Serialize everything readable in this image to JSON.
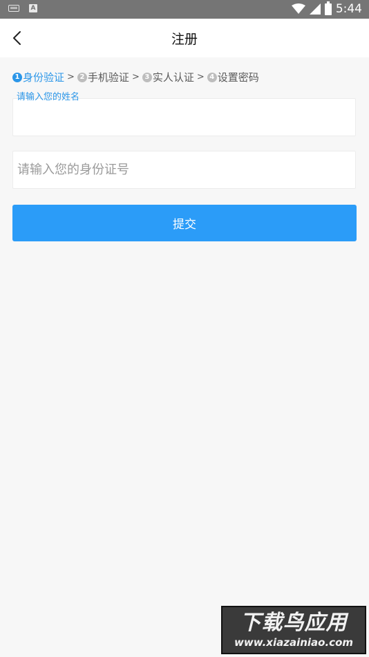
{
  "status_bar": {
    "time": "5:44",
    "left_icons": [
      "keyboard-icon",
      "a-badge-icon"
    ],
    "right_icons": [
      "wifi-icon",
      "signal-icon",
      "battery-icon"
    ]
  },
  "header": {
    "title": "注册",
    "back_icon": "chevron-left-icon"
  },
  "steps": [
    {
      "number": "1",
      "label": "身份验证",
      "active": true
    },
    {
      "number": "2",
      "label": "手机验证",
      "active": false
    },
    {
      "number": "3",
      "label": "实人认证",
      "active": false
    },
    {
      "number": "4",
      "label": "设置密码",
      "active": false
    }
  ],
  "step_separator": ">",
  "form": {
    "name_label": "请输入您的姓名",
    "name_value": "",
    "id_placeholder": "请输入您的身份证号",
    "id_value": "",
    "submit_label": "提交"
  },
  "watermark": {
    "title": "下载鸟应用",
    "url": "www.xiazainiao.com"
  },
  "colors": {
    "accent": "#2b96e8",
    "button": "#2b9cf8",
    "status_bar": "#757575",
    "background": "#f7f7f7"
  }
}
